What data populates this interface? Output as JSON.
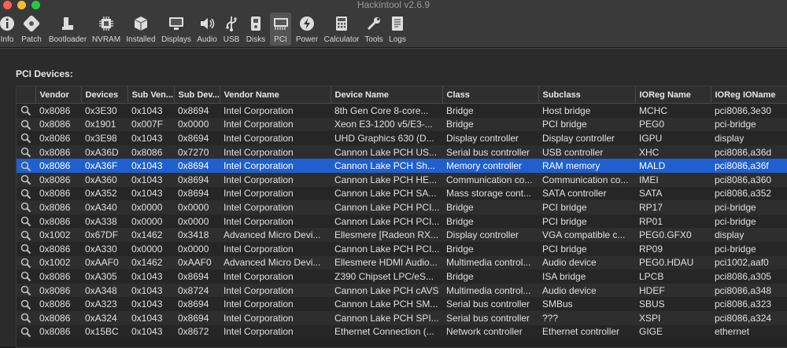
{
  "window": {
    "title": "Hackintool v2.6.9"
  },
  "toolbar": [
    {
      "label": "Info",
      "icon": "info-icon"
    },
    {
      "label": "Patch",
      "icon": "patch-icon"
    },
    {
      "label": "Bootloader",
      "icon": "boot-icon"
    },
    {
      "label": "NVRAM",
      "icon": "chip-icon"
    },
    {
      "label": "Installed",
      "icon": "box-icon"
    },
    {
      "label": "Displays",
      "icon": "monitor-icon"
    },
    {
      "label": "Audio",
      "icon": "speaker-icon"
    },
    {
      "label": "USB",
      "icon": "usb-icon"
    },
    {
      "label": "Disks",
      "icon": "disk-icon"
    },
    {
      "label": "PCI",
      "icon": "pci-icon"
    },
    {
      "label": "Power",
      "icon": "power-icon"
    },
    {
      "label": "Calculator",
      "icon": "calculator-icon"
    },
    {
      "label": "Tools",
      "icon": "tools-icon"
    },
    {
      "label": "Logs",
      "icon": "logs-icon"
    }
  ],
  "section_title": "PCI Devices:",
  "columns": [
    "",
    "Vendor",
    "Devices",
    "Sub Ven...",
    "Sub Dev...",
    "Vendor Name",
    "Device Name",
    "Class",
    "Subclass",
    "IOReg Name",
    "IOReg IOName"
  ],
  "selected_row": 4,
  "colors": {
    "selection": "#1f5fd0"
  },
  "rows": [
    [
      "0x8086",
      "0x3E30",
      "0x1043",
      "0x8694",
      "Intel Corporation",
      "8th Gen Core 8-core...",
      "Bridge",
      "Host bridge",
      "MCHC",
      "pci8086,3e30"
    ],
    [
      "0x8086",
      "0x1901",
      "0x007F",
      "0x0000",
      "Intel Corporation",
      "Xeon E3-1200 v5/E3-...",
      "Bridge",
      "PCI bridge",
      "PEG0",
      "pci-bridge"
    ],
    [
      "0x8086",
      "0x3E98",
      "0x1043",
      "0x8694",
      "Intel Corporation",
      "UHD Graphics 630 (D...",
      "Display controller",
      "Display controller",
      "IGPU",
      "display"
    ],
    [
      "0x8086",
      "0xA36D",
      "0x8086",
      "0x7270",
      "Intel Corporation",
      "Cannon Lake PCH US...",
      "Serial bus controller",
      "USB controller",
      "XHC",
      "pci8086,a36d"
    ],
    [
      "0x8086",
      "0xA36F",
      "0x1043",
      "0x8694",
      "Intel Corporation",
      "Cannon Lake PCH Sh...",
      "Memory controller",
      "RAM memory",
      "MALD",
      "pci8086,a36f"
    ],
    [
      "0x8086",
      "0xA360",
      "0x1043",
      "0x8694",
      "Intel Corporation",
      "Cannon Lake PCH HE...",
      "Communication co...",
      "Communication co...",
      "IMEI",
      "pci8086,a360"
    ],
    [
      "0x8086",
      "0xA352",
      "0x1043",
      "0x8694",
      "Intel Corporation",
      "Cannon Lake PCH SA...",
      "Mass storage cont...",
      "SATA controller",
      "SATA",
      "pci8086,a352"
    ],
    [
      "0x8086",
      "0xA340",
      "0x0000",
      "0x0000",
      "Intel Corporation",
      "Cannon Lake PCH PCI...",
      "Bridge",
      "PCI bridge",
      "RP17",
      "pci-bridge"
    ],
    [
      "0x8086",
      "0xA338",
      "0x0000",
      "0x0000",
      "Intel Corporation",
      "Cannon Lake PCH PCI...",
      "Bridge",
      "PCI bridge",
      "RP01",
      "pci-bridge"
    ],
    [
      "0x1002",
      "0x67DF",
      "0x1462",
      "0x3418",
      "Advanced Micro Devi...",
      "Ellesmere [Radeon RX...",
      "Display controller",
      "VGA compatible c...",
      "PEG0.GFX0",
      "display"
    ],
    [
      "0x8086",
      "0xA330",
      "0x0000",
      "0x0000",
      "Intel Corporation",
      "Cannon Lake PCH PCI...",
      "Bridge",
      "PCI bridge",
      "RP09",
      "pci-bridge"
    ],
    [
      "0x1002",
      "0xAAF0",
      "0x1462",
      "0xAAF0",
      "Advanced Micro Devi...",
      "Ellesmere HDMI Audio...",
      "Multimedia control...",
      "Audio device",
      "PEG0.HDAU",
      "pci1002,aaf0"
    ],
    [
      "0x8086",
      "0xA305",
      "0x1043",
      "0x8694",
      "Intel Corporation",
      "Z390 Chipset LPC/eS...",
      "Bridge",
      "ISA bridge",
      "LPCB",
      "pci8086,a305"
    ],
    [
      "0x8086",
      "0xA348",
      "0x1043",
      "0x8724",
      "Intel Corporation",
      "Cannon Lake PCH cAVS",
      "Multimedia control...",
      "Audio device",
      "HDEF",
      "pci8086,a348"
    ],
    [
      "0x8086",
      "0xA323",
      "0x1043",
      "0x8694",
      "Intel Corporation",
      "Cannon Lake PCH SM...",
      "Serial bus controller",
      "SMBus",
      "SBUS",
      "pci8086,a323"
    ],
    [
      "0x8086",
      "0xA324",
      "0x1043",
      "0x8694",
      "Intel Corporation",
      "Cannon Lake PCH SPI...",
      "Serial bus controller",
      "???",
      "XSPI",
      "pci8086,a324"
    ],
    [
      "0x8086",
      "0x15BC",
      "0x1043",
      "0x8672",
      "Intel Corporation",
      "Ethernet Connection (...",
      "Network controller",
      "Ethernet controller",
      "GIGE",
      "ethernet"
    ]
  ]
}
